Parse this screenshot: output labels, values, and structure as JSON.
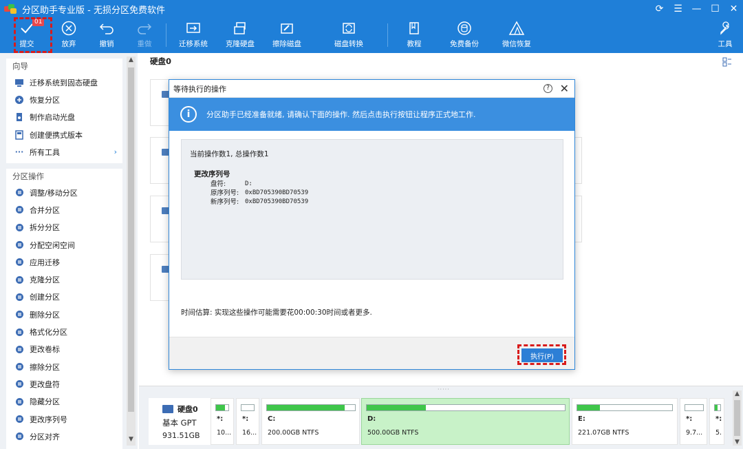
{
  "window": {
    "title": "分区助手专业版 - 无损分区免费软件",
    "controls": [
      "refresh-icon",
      "menu-icon",
      "minimize-icon",
      "maximize-icon",
      "close-icon"
    ]
  },
  "toolbar": {
    "commit": {
      "label": "提交",
      "badge": "01"
    },
    "discard": {
      "label": "放弃"
    },
    "undo": {
      "label": "撤销"
    },
    "redo": {
      "label": "重做"
    },
    "migrate": {
      "label": "迁移系统"
    },
    "clone": {
      "label": "克隆硬盘"
    },
    "wipe": {
      "label": "擦除磁盘"
    },
    "convert": {
      "label": "磁盘转换"
    },
    "tutorial": {
      "label": "教程"
    },
    "backup": {
      "label": "免费备份"
    },
    "wechat": {
      "label": "微信恢复"
    },
    "tools": {
      "label": "工具"
    }
  },
  "sidebar": {
    "wizard_title": "向导",
    "wizard_items": [
      {
        "label": "迁移系统到固态硬盘",
        "icon": "migrate-icon"
      },
      {
        "label": "恢复分区",
        "icon": "recover-icon"
      },
      {
        "label": "制作启动光盘",
        "icon": "disc-icon"
      },
      {
        "label": "创建便携式版本",
        "icon": "portable-icon"
      },
      {
        "label": "所有工具",
        "icon": "more-icon"
      }
    ],
    "ops_title": "分区操作",
    "ops_items": [
      {
        "label": "调整/移动分区"
      },
      {
        "label": "合并分区"
      },
      {
        "label": "拆分分区"
      },
      {
        "label": "分配空闲空间"
      },
      {
        "label": "应用迁移"
      },
      {
        "label": "克隆分区"
      },
      {
        "label": "创建分区"
      },
      {
        "label": "删除分区"
      },
      {
        "label": "格式化分区"
      },
      {
        "label": "更改卷标"
      },
      {
        "label": "擦除分区"
      },
      {
        "label": "更改盘符"
      },
      {
        "label": "隐藏分区"
      },
      {
        "label": "更改序列号"
      },
      {
        "label": "分区对齐"
      }
    ]
  },
  "main": {
    "disk_title": "硬盘0"
  },
  "dialog": {
    "title": "等待执行的操作",
    "banner": "分区助手已经准备就绪, 请确认下面的操作. 然后点击执行按钮让程序正式地工作.",
    "ops_count": "当前操作数1, 总操作数1",
    "op_title": "更改序列号",
    "op_rows": [
      {
        "k": "盘符:",
        "v": "D:"
      },
      {
        "k": "原序列号:",
        "v": "0xBD705390BD70539"
      },
      {
        "k": "新序列号:",
        "v": "0xBD705390BD70539"
      }
    ],
    "estimate": "时间估算: 实现这些操作可能需要花00:00:30时间或者更多.",
    "execute_label": "执行(P)"
  },
  "diskmap": {
    "disk_name": "硬盘0",
    "disk_type": "基本 GPT",
    "disk_size": "931.51GB",
    "partitions": [
      {
        "label": "*:",
        "info": "10...",
        "fill": 0.7
      },
      {
        "label": "*:",
        "info": "16...",
        "fill": 0.0
      },
      {
        "label": "C:",
        "info": "200.00GB NTFS",
        "fill": 0.88
      },
      {
        "label": "D:",
        "info": "500.00GB NTFS",
        "fill": 0.3
      },
      {
        "label": "E:",
        "info": "221.07GB NTFS",
        "fill": 0.24
      },
      {
        "label": "*:",
        "info": "9.7...",
        "fill": 0.0
      },
      {
        "label": "*:",
        "info": "5.",
        "fill": 0.5
      }
    ]
  },
  "colors": {
    "accent": "#1f7fd8",
    "highlight_red": "#d81b1b",
    "used_green": "#3fc64a",
    "selected_partition": "#c8f2c8"
  }
}
